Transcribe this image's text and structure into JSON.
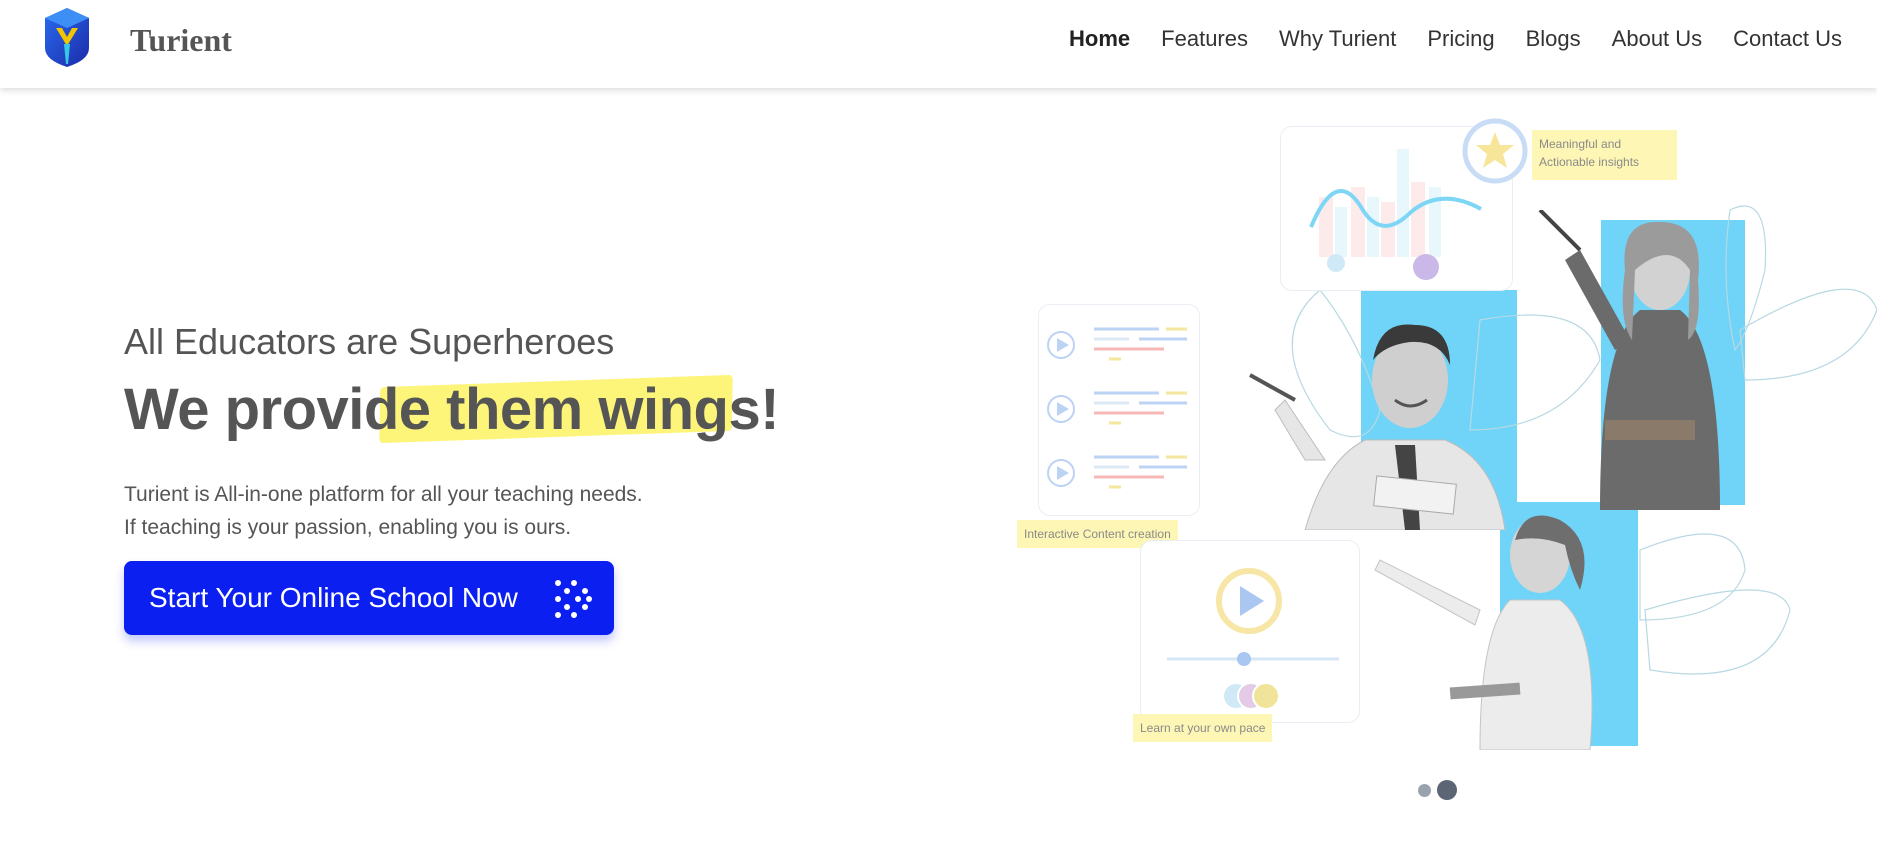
{
  "brand": {
    "name": "Turient"
  },
  "nav": {
    "items": [
      {
        "label": "Home",
        "active": true
      },
      {
        "label": "Features"
      },
      {
        "label": "Why Turient"
      },
      {
        "label": "Pricing"
      },
      {
        "label": "Blogs"
      },
      {
        "label": "About Us"
      },
      {
        "label": "Contact Us"
      }
    ]
  },
  "hero": {
    "kicker": "All Educators are Superheroes",
    "headline_a": "We provide ",
    "headline_b": "them wings",
    "headline_c": "!",
    "desc_line1": "Turient is All-in-one platform for all your teaching needs.",
    "desc_line2": "If teaching is your passion, enabling you is ours.",
    "cta_label": "Start Your Online School Now"
  },
  "illustration": {
    "tag_insights": "Meaningful and\nActionable insights",
    "tag_content": "Interactive Content creation",
    "tag_pace": "Learn at your own pace"
  },
  "carousel": {
    "active_index": 1,
    "count": 2
  },
  "colors": {
    "accent": "#0a1ff0",
    "highlight": "#fdf47a",
    "block": "#6fd4f7",
    "tag_bg": "#fdf6b5"
  }
}
